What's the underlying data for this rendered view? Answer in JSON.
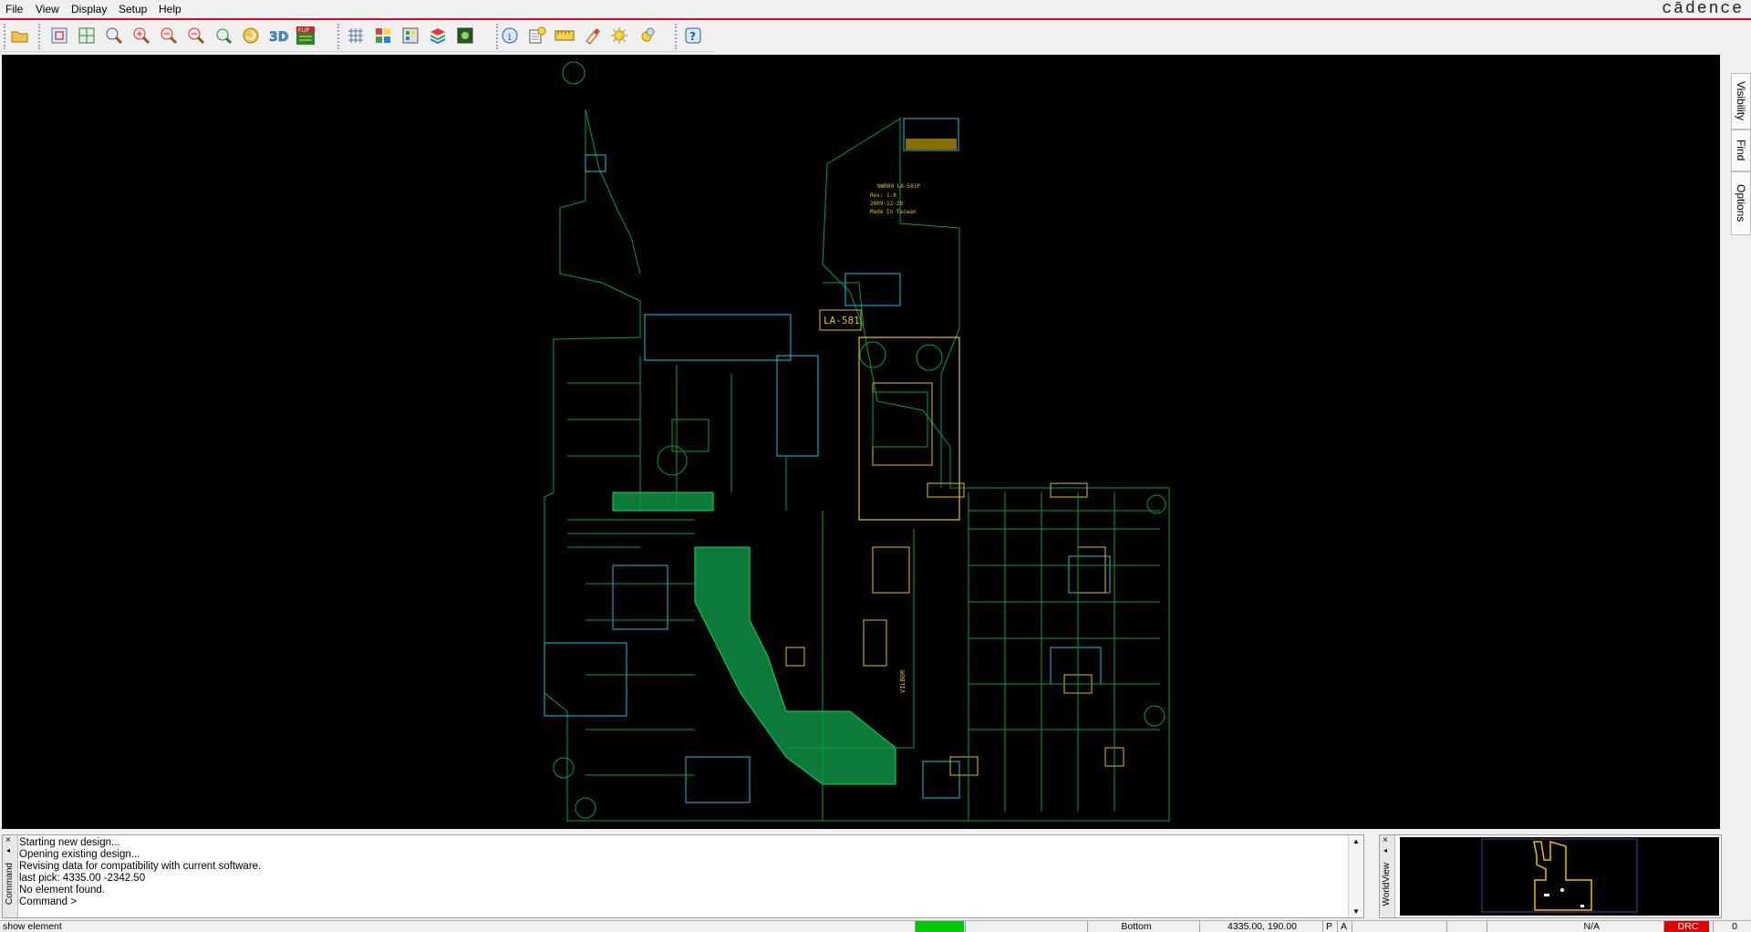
{
  "menu": {
    "file": "File",
    "view": "View",
    "display": "Display",
    "setup": "Setup",
    "help": "Help"
  },
  "brand": "cādence",
  "toolbar": {
    "icons": [
      "open-folder-icon",
      "zoom-fit-icon",
      "zoom-world-icon",
      "zoom-window-icon",
      "zoom-in-icon",
      "zoom-out-icon",
      "zoom-previous-icon",
      "zoom-center-icon",
      "redraw-icon",
      "3d-view-icon",
      "flip-design-icon",
      "grid-icon",
      "color-icon",
      "layer-visibility-icon",
      "layers-stack-icon",
      "shaded-view-icon",
      "info-icon",
      "reports-icon",
      "measure-icon",
      "highlight-icon",
      "brightness-icon",
      "shadow-mode-icon",
      "help-icon"
    ],
    "flip_label": "FLIP"
  },
  "side_tabs": {
    "visibility": "Visibility",
    "find": "Find",
    "options": "Options"
  },
  "board": {
    "silk_label": "LA-581",
    "silk_text": [
      "NWR00 LA-581P",
      "Rev: 1.0",
      "2009-12-28",
      "Made In Taiwan"
    ],
    "colors": {
      "trace": "#00b050",
      "copper": "#00e060",
      "outline": "#e8c000",
      "pin": "#19c3e6",
      "ref": "#1e5cff"
    }
  },
  "command": {
    "lines": [
      "Starting new design...",
      "Opening existing design...",
      "Revising data for compatibility with current software.",
      "last pick:  4335.00 -2342.50",
      "No element found.",
      "Command >"
    ],
    "panel_label": "Command"
  },
  "worldview": {
    "panel_label": "WorldView"
  },
  "status": {
    "hint": "show element",
    "layer": "Bottom",
    "coords": "4335.00, 190.00",
    "p": "P",
    "a": "A",
    "na": "N/A",
    "drc": "DRC",
    "count": "0",
    "colors": {
      "idle": "#00c800",
      "drc": "#e00000"
    }
  }
}
